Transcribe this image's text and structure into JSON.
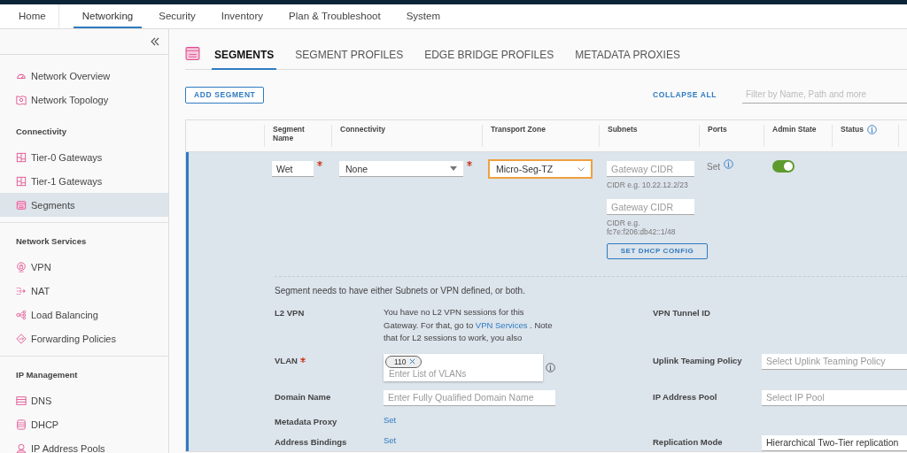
{
  "top_nav": [
    {
      "label": "Home",
      "selected": false
    },
    {
      "label": "Networking",
      "selected": true
    },
    {
      "label": "Security",
      "selected": false
    },
    {
      "label": "Inventory",
      "selected": false
    },
    {
      "label": "Plan & Troubleshoot",
      "selected": false
    },
    {
      "label": "System",
      "selected": false
    }
  ],
  "sidebar": {
    "sections": [
      {
        "items": [
          {
            "label": "Network Overview",
            "kind": "gauge",
            "selected": false
          },
          {
            "label": "Network Topology",
            "kind": "topology",
            "selected": false
          }
        ]
      },
      {
        "heading": "Connectivity",
        "items": [
          {
            "label": "Tier-0 Gateways",
            "kind": "gateway",
            "selected": false
          },
          {
            "label": "Tier-1 Gateways",
            "kind": "gateway",
            "selected": false
          },
          {
            "label": "Segments",
            "kind": "segment",
            "selected": true
          }
        ]
      },
      {
        "heading": "Network Services",
        "items": [
          {
            "label": "VPN",
            "kind": "vpn",
            "selected": false
          },
          {
            "label": "NAT",
            "kind": "nat",
            "selected": false
          },
          {
            "label": "Load Balancing",
            "kind": "balancer",
            "selected": false
          },
          {
            "label": "Forwarding Policies",
            "kind": "forwarding",
            "selected": false
          }
        ]
      },
      {
        "heading": "IP Management",
        "items": [
          {
            "label": "DNS",
            "kind": "dns",
            "selected": false
          },
          {
            "label": "DHCP",
            "kind": "dhcp",
            "selected": false
          },
          {
            "label": "IP Address Pools",
            "kind": "pool",
            "selected": false
          }
        ]
      }
    ]
  },
  "tabs": [
    {
      "label": "SEGMENTS",
      "selected": true
    },
    {
      "label": "SEGMENT PROFILES",
      "selected": false
    },
    {
      "label": "EDGE BRIDGE PROFILES",
      "selected": false
    },
    {
      "label": "METADATA PROXIES",
      "selected": false
    }
  ],
  "add_button": "ADD SEGMENT",
  "collapse_all": "COLLAPSE ALL",
  "filter": {
    "placeholder": "Filter by Name, Path and more"
  },
  "table": {
    "columns": [
      {
        "label": "Segment Name",
        "info": false
      },
      {
        "label": "Connectivity",
        "info": false
      },
      {
        "label": "Transport Zone",
        "info": false
      },
      {
        "label": "Subnets",
        "info": false
      },
      {
        "label": "Ports",
        "info": false
      },
      {
        "label": "Admin State",
        "info": false
      },
      {
        "label": "Status",
        "info": true
      }
    ],
    "row": {
      "name": {
        "value": "Wet",
        "required": true
      },
      "connectivity": {
        "value": "None",
        "required": true
      },
      "transport_zone": {
        "value": "Micro-Seg-TZ",
        "focused": true
      },
      "subnets": [
        {
          "placeholder": "Gateway CIDR",
          "hint": "CIDR e.g. 10.22.12.2/23"
        },
        {
          "placeholder": "Gateway CIDR",
          "hint": "CIDR e.g. fc7e:f206:db42::1/48"
        }
      ],
      "dhcp_button": "SET DHCP CONFIG",
      "ports": "Set",
      "admin_state_on": true
    }
  },
  "details": {
    "notice": "Segment needs to have either Subnets or VPN defined, or both.",
    "l2vpn": {
      "label": "L2 VPN",
      "text_before": "You have no L2 VPN sessions for this Gateway. For that, go to",
      "link": "VPN Services",
      "text_after": ". Note that for L2 sessions to work, you also"
    },
    "vlan": {
      "label": "VLAN",
      "required": true,
      "chips": [
        "110"
      ],
      "placeholder": "Enter List of VLANs"
    },
    "domain": {
      "label": "Domain Name",
      "placeholder": "Enter Fully Qualified Domain Name"
    },
    "metadata_proxy": {
      "label": "Metadata Proxy",
      "link": "Set"
    },
    "address_bindings": {
      "label": "Address Bindings",
      "link": "Set"
    },
    "vpn_tunnel": {
      "label": "VPN Tunnel ID"
    },
    "uplink": {
      "label": "Uplink Teaming Policy",
      "placeholder": "Select Uplink Teaming Policy"
    },
    "ip_pool": {
      "label": "IP Address Pool",
      "placeholder": "Select IP Pool"
    },
    "replication": {
      "label": "Replication Mode",
      "value": "Hierarchical Two-Tier replication"
    }
  }
}
